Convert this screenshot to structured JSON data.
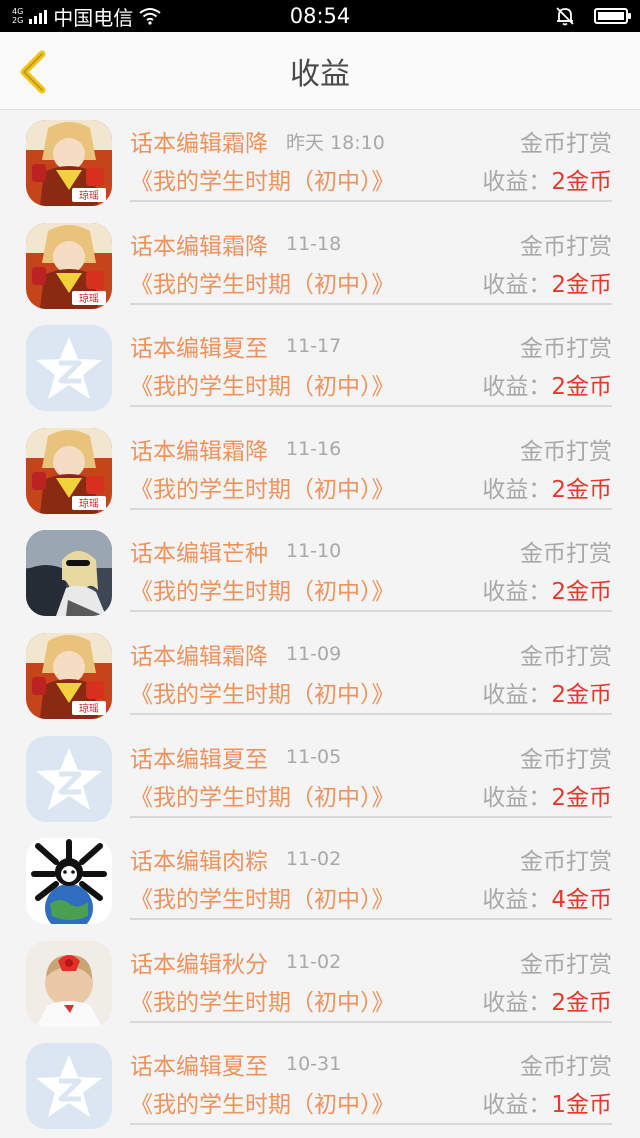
{
  "status_bar": {
    "network_top": "4G",
    "network_bottom": "2G",
    "carrier": "中国电信",
    "time": "08:54"
  },
  "nav": {
    "title": "收益"
  },
  "income_label": "收益：",
  "records": [
    {
      "editor": "话本编辑霜降",
      "date": "昨天 18:10",
      "type": "金币打赏",
      "book": "《我的学生时期（初中）》",
      "amount": "2金币",
      "avatar": "anime-avatar"
    },
    {
      "editor": "话本编辑霜降",
      "date": "11-18",
      "type": "金币打赏",
      "book": "《我的学生时期（初中）》",
      "amount": "2金币",
      "avatar": "anime-avatar"
    },
    {
      "editor": "话本编辑夏至",
      "date": "11-17",
      "type": "金币打赏",
      "book": "《我的学生时期（初中）》",
      "amount": "2金币",
      "avatar": "qq-default-avatar"
    },
    {
      "editor": "话本编辑霜降",
      "date": "11-16",
      "type": "金币打赏",
      "book": "《我的学生时期（初中）》",
      "amount": "2金币",
      "avatar": "anime-avatar"
    },
    {
      "editor": "话本编辑芒种",
      "date": "11-10",
      "type": "金币打赏",
      "book": "《我的学生时期（初中）》",
      "amount": "2金币",
      "avatar": "photo-avatar"
    },
    {
      "editor": "话本编辑霜降",
      "date": "11-09",
      "type": "金币打赏",
      "book": "《我的学生时期（初中）》",
      "amount": "2金币",
      "avatar": "anime-avatar"
    },
    {
      "editor": "话本编辑夏至",
      "date": "11-05",
      "type": "金币打赏",
      "book": "《我的学生时期（初中）》",
      "amount": "2金币",
      "avatar": "qq-default-avatar"
    },
    {
      "editor": "话本编辑肉粽",
      "date": "11-02",
      "type": "金币打赏",
      "book": "《我的学生时期（初中）》",
      "amount": "4金币",
      "avatar": "globe-avatar"
    },
    {
      "editor": "话本编辑秋分",
      "date": "11-02",
      "type": "金币打赏",
      "book": "《我的学生时期（初中）》",
      "amount": "2金币",
      "avatar": "girl-avatar"
    },
    {
      "editor": "话本编辑夏至",
      "date": "10-31",
      "type": "金币打赏",
      "book": "《我的学生时期（初中）》",
      "amount": "1金币",
      "avatar": "qq-default-avatar"
    }
  ],
  "colors": {
    "accent_orange": "#f0925c",
    "amount_red": "#e8372d",
    "gray_text": "#a8a8a8",
    "back_arrow": "#f3c21b"
  }
}
